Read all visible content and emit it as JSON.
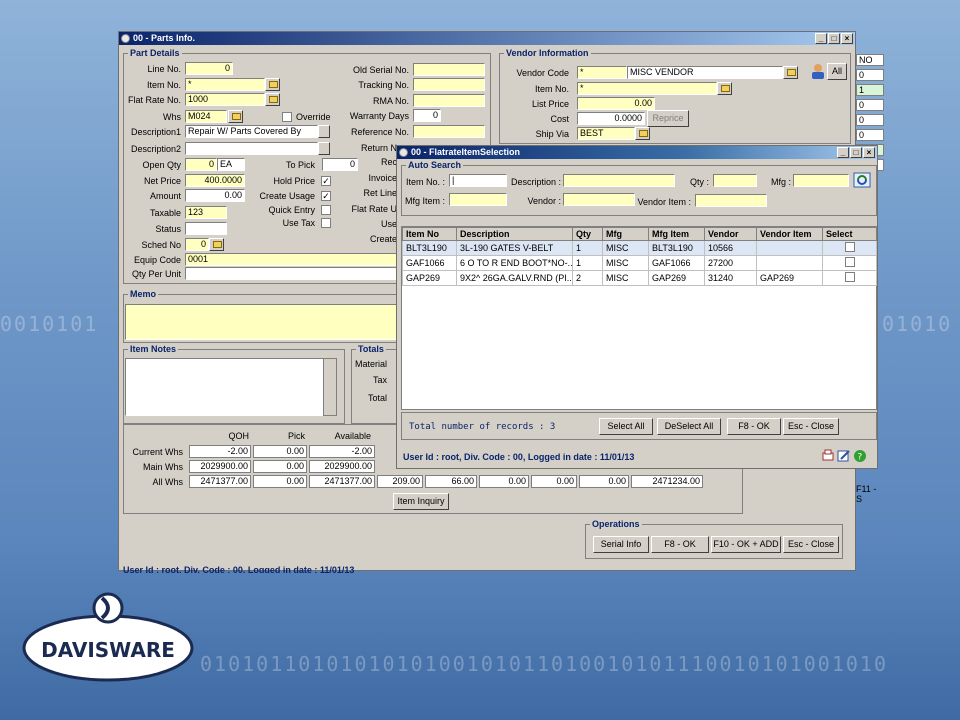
{
  "background_text": [
    "0010101",
    "010101010110100101010100101",
    "0101011010101010100101011010010101110010101001010"
  ],
  "logo": {
    "text": "DAVISWARE"
  },
  "main_window": {
    "title": "00 - Parts Info.",
    "part_details": {
      "legend": "Part Details",
      "line_no": {
        "label": "Line No.",
        "value": "0"
      },
      "item_no": {
        "label": "Item No.",
        "value": "*"
      },
      "flat_rate_no": {
        "label": "Flat Rate No.",
        "value": "1000"
      },
      "whs": {
        "label": "Whs",
        "value": "M024"
      },
      "override": "Override",
      "description1": {
        "label": "Description1",
        "value": "Repair W/ Parts Covered By"
      },
      "description2": {
        "label": "Description2",
        "value": ""
      },
      "open_qty": {
        "label": "Open Qty",
        "value": "0",
        "unit": "EA"
      },
      "to_pick": {
        "label": "To Pick",
        "value": "0"
      },
      "net_price": {
        "label": "Net Price",
        "value": "400.0000"
      },
      "hold_price": "Hold Price",
      "amount": {
        "label": "Amount",
        "value": "0.00"
      },
      "create_usage": "Create Usage",
      "quick_entry": "Quick Entry",
      "taxable": {
        "label": "Taxable",
        "value": "123"
      },
      "use_tax": "Use Tax",
      "status": {
        "label": "Status",
        "value": ""
      },
      "sched_no": {
        "label": "Sched No",
        "value": "0"
      },
      "equip_code": {
        "label": "Equip Code",
        "value": "0001"
      },
      "qty_per_unit": {
        "label": "Qty Per Unit",
        "value": ""
      },
      "old_serial_no": "Old Serial No.",
      "tracking_no": "Tracking No.",
      "rma_no": "RMA No.",
      "warranty_days": {
        "label": "Warranty Days",
        "value": "0"
      },
      "reference_no": "Reference No.",
      "return_no": "Return N",
      "rec": "Rec",
      "invoice": "Invoice",
      "ret_line": "Ret Line",
      "flat_rate_u": "Flat Rate U",
      "use": "Use",
      "create": "Create"
    },
    "vendor_info": {
      "legend": "Vendor Information",
      "vendor_code": {
        "label": "Vendor Code",
        "value": "*",
        "name": "MISC VENDOR"
      },
      "all_button": "All",
      "item_no": {
        "label": "Item No.",
        "value": "*"
      },
      "list_price": {
        "label": "List Price",
        "value": "0.00"
      },
      "cost": {
        "label": "Cost",
        "value": "0.0000"
      },
      "reprice_button": "Reprice",
      "ship_via": {
        "label": "Ship Via",
        "value": "BEST"
      }
    },
    "memo": {
      "legend": "Memo"
    },
    "item_notes": {
      "legend": "Item Notes"
    },
    "totals": {
      "legend": "Totals",
      "material": "Material",
      "tax": "Tax",
      "total": "Total"
    },
    "inventory": {
      "headers": [
        "QOH",
        "Pick",
        "Available"
      ],
      "rows": [
        {
          "label": "Current Whs",
          "values": [
            "-2.00",
            "0.00",
            "-2.00"
          ]
        },
        {
          "label": "Main Whs",
          "values": [
            "2029900.00",
            "0.00",
            "2029900.00"
          ]
        },
        {
          "label": "All Whs",
          "values": [
            "2471377.00",
            "0.00",
            "2471377.00",
            "209.00",
            "66.00",
            "0.00",
            "0.00",
            "0.00",
            "2471234.00"
          ]
        }
      ],
      "item_inquiry_button": "Item Inquiry"
    },
    "operations": {
      "legend": "Operations",
      "buttons": [
        "Serial Info",
        "F8 - OK",
        "F10 - OK + ADD",
        "Esc - Close"
      ]
    },
    "status_bar": "User Id : root, Div. Code : 00, Logged in date : 11/01/13",
    "side_column": [
      "NO",
      "0",
      "1",
      "0",
      "0",
      "0",
      "1",
      "0"
    ],
    "side_f11": "F11 - S"
  },
  "dialog": {
    "title": "00 - FlatrateItemSelection",
    "auto_search": {
      "legend": "Auto Search",
      "item_no": "Item No. :",
      "description": "Description :",
      "qty": "Qty :",
      "mfg": "Mfg :",
      "mfg_item": "Mfg Item :",
      "vendor": "Vendor :",
      "vendor_item": "Vendor Item :"
    },
    "table": {
      "headers": [
        "Item No",
        "Description",
        "Qty",
        "Mfg",
        "Mfg Item",
        "Vendor",
        "Vendor Item",
        "Select"
      ],
      "rows": [
        [
          "BLT3L190",
          "3L-190 GATES V-BELT",
          "1",
          "MISC",
          "BLT3L190",
          "10566",
          ""
        ],
        [
          "GAF1066",
          "6 O TO R END BOOT*NO-...",
          "1",
          "MISC",
          "GAF1066",
          "27200",
          ""
        ],
        [
          "GAP269",
          "9X2^ 26GA.GALV.RND (PI...",
          "2",
          "MISC",
          "GAP269",
          "31240",
          "GAP269"
        ]
      ]
    },
    "total_records": "Total number of records : 3",
    "buttons": [
      "Select All",
      "DeSelect All",
      "F8 - OK",
      "Esc - Close"
    ],
    "status_bar": "User Id : root, Div. Code : 00, Logged in date : 11/01/13"
  },
  "colors": {
    "field_yellow": "#ffffc0",
    "title_blue": "#0a246a",
    "status_blue": "#0a246a"
  }
}
